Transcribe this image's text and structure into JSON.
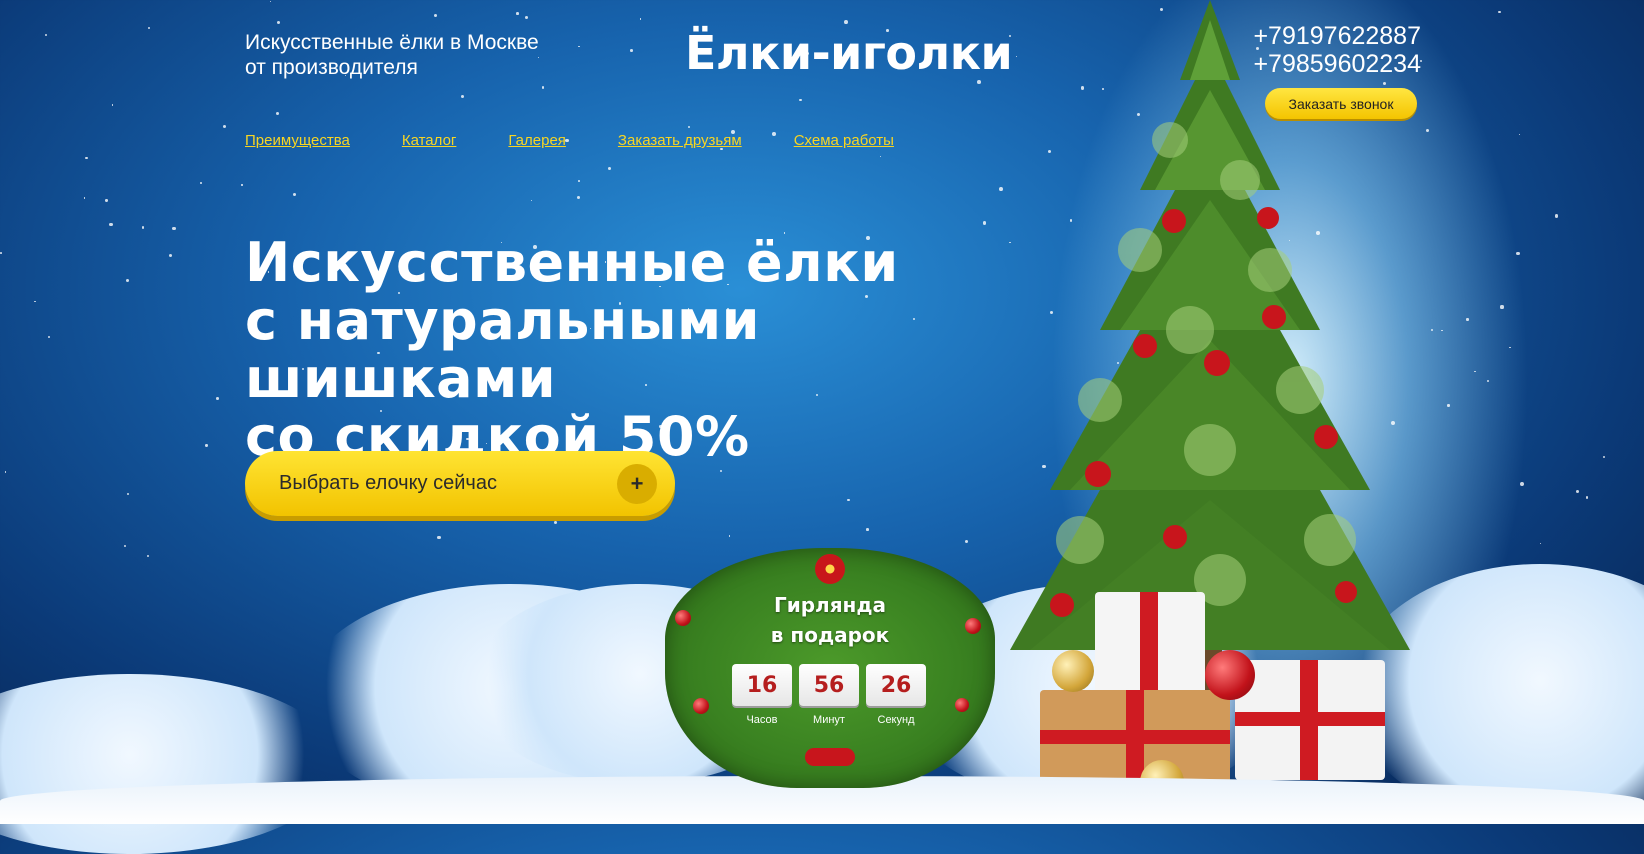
{
  "header": {
    "tagline_line1": "Искусственные ёлки в Москве",
    "tagline_line2": "от производителя",
    "logo": "Ёлки-иголки",
    "phones": [
      "+79197622887",
      "+79859602234"
    ],
    "call_button_label": "Заказать звонок"
  },
  "nav": {
    "items": [
      "Преимущества",
      "Каталог",
      "Галерея",
      "Заказать друзьям",
      "Схема работы"
    ]
  },
  "hero": {
    "headline_lines": [
      "Искусственные ёлки",
      "с натуральными шишками",
      "со скидкой 50%"
    ],
    "cta_label": "Выбрать елочку сейчас",
    "cta_icon": "plus-icon"
  },
  "promo": {
    "title_line1": "Гирлянда",
    "title_line2": "в подарок",
    "timer": [
      {
        "value": "16",
        "label": "Часов"
      },
      {
        "value": "56",
        "label": "Минут"
      },
      {
        "value": "26",
        "label": "Секунд"
      }
    ]
  },
  "colors": {
    "accent": "#f4c400",
    "nav_link": "#f7d523",
    "timer_digits": "#b51e1e",
    "sky": "#1763ad"
  }
}
